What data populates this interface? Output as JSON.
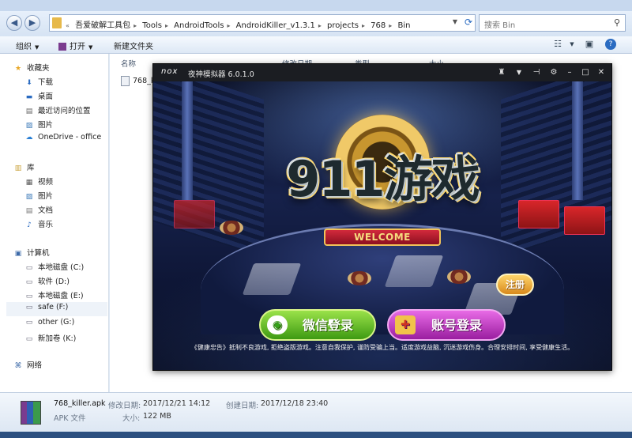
{
  "explorer": {
    "breadcrumbs": [
      "吾爱破解工具包",
      "Tools",
      "AndroidTools",
      "AndroidKiller_v1.3.1",
      "projects",
      "768",
      "Bin"
    ],
    "search_placeholder": "搜索 Bin",
    "toolbar": {
      "organize": "组织",
      "open": "打开",
      "new_folder": "新建文件夹"
    },
    "columns": [
      "名称",
      "修改日期",
      "类型",
      "大小"
    ],
    "file_name_visible": "768_k",
    "sidebar": {
      "favorites": "收藏夹",
      "fav_items": [
        "下载",
        "桌面",
        "最近访问的位置",
        "图片",
        "OneDrive - office"
      ],
      "libraries": "库",
      "lib_items": [
        "视频",
        "图片",
        "文档",
        "音乐"
      ],
      "computer": "计算机",
      "drives": [
        "本地磁盘 (C:)",
        "软件 (D:)",
        "本地磁盘 (E:)",
        "safe (F:)",
        "other (G:)",
        "新加卷 (K:)"
      ],
      "network": "网络"
    },
    "details": {
      "name": "768_killer.apk",
      "type": "APK 文件",
      "modified_label": "修改日期:",
      "modified": "2017/12/21 14:12",
      "size_label": "大小:",
      "size": "122 MB",
      "created_label": "创建日期:",
      "created": "2017/12/18 23:40"
    }
  },
  "nox": {
    "logo": "nox",
    "title": "夜神模拟器 6.0.1.0",
    "game": {
      "logo_text": "911游戏",
      "ribbon": "WELCOME",
      "wechat_login": "微信登录",
      "account_login": "账号登录",
      "register": "注册",
      "notice": "《健康忠告》抵制不良游戏, 拒绝盗版游戏。注意自我保护, 谨防受骗上当。适度游戏益脑, 沉迷游戏伤身。合理安排时间, 享受健康生活。"
    }
  }
}
